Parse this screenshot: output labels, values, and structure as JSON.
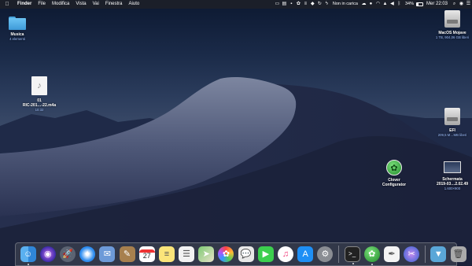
{
  "menubar": {
    "apple_icon": "apple-logo-icon",
    "menus": [
      "Finder",
      "File",
      "Modifica",
      "Vista",
      "Vai",
      "Finestra",
      "Aiuto"
    ],
    "status_text": "Non in carica",
    "battery_percent": "34%",
    "battery_level": 0.34,
    "clock": "Mer 22:03"
  },
  "desktop": {
    "musica": {
      "label": "Musica",
      "sub": "4 elementi"
    },
    "audio_file": {
      "label": "01",
      "label2": "RIC-201…-22.m4a",
      "sub": "10:32"
    },
    "macos_disk": {
      "label": "MacOS Mojave",
      "sub": "1 TB, 904,06 GB liberi"
    },
    "efi_disk": {
      "label": "EFI",
      "sub": "209,5 M…MB liberi"
    },
    "clover": {
      "label": "Clover",
      "label2": "Configurator"
    },
    "screenshot": {
      "label": "Schermata",
      "label2": "2019-03…2.02.49",
      "sub": "1.600×900"
    }
  },
  "dock": {
    "background": "#464a56",
    "apps": [
      "finder-icon",
      "siri-icon",
      "launchpad-icon",
      "safari-icon",
      "mail-icon",
      "notes-icon",
      "calendar-icon",
      "stickies-icon",
      "reminders-icon",
      "maps-icon",
      "photos-icon",
      "messages-icon",
      "facetime-icon",
      "itunes-icon",
      "app-store-icon",
      "system-preferences-icon",
      "terminal-icon",
      "clover-configurator-icon",
      "textedit-icon",
      "screen-capture-icon",
      "downloads-folder-icon",
      "trash-icon"
    ],
    "calendar_day": "27"
  }
}
